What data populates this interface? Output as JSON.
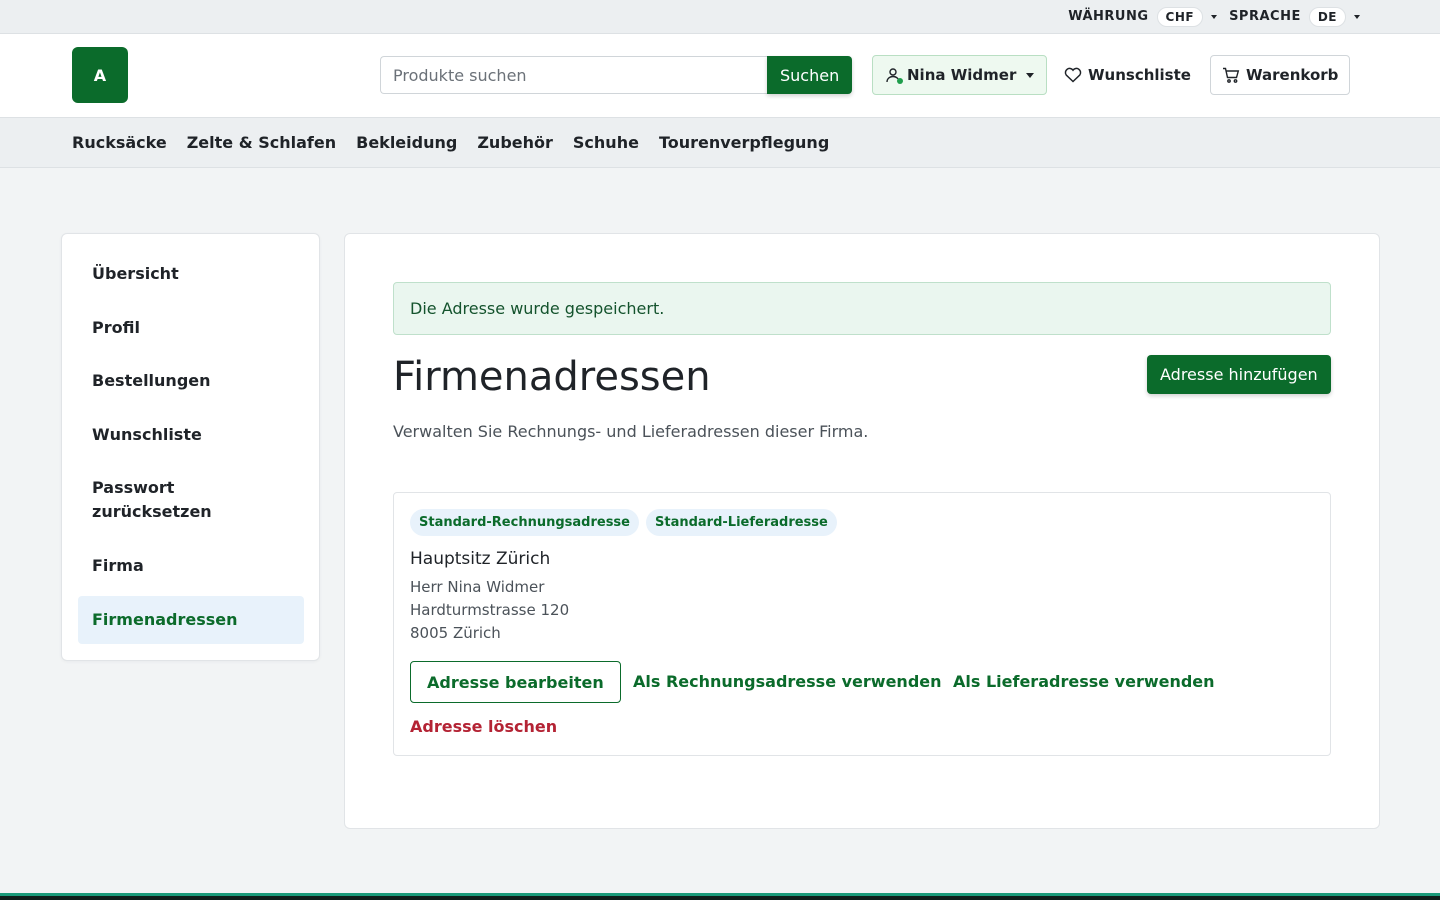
{
  "utility": {
    "currency_label": "WÄHRUNG",
    "currency_value": "CHF",
    "language_label": "SPRACHE",
    "language_value": "DE"
  },
  "header": {
    "logo_text": "A",
    "search_placeholder": "Produkte suchen",
    "search_button": "Suchen",
    "account_name": "Nina Widmer",
    "wishlist_label": "Wunschliste",
    "cart_label": "Warenkorb"
  },
  "categories": [
    "Rucksäcke",
    "Zelte & Schlafen",
    "Bekleidung",
    "Zubehör",
    "Schuhe",
    "Tourenverpflegung"
  ],
  "sidebar": {
    "items": [
      {
        "label": "Übersicht"
      },
      {
        "label": "Profil"
      },
      {
        "label": "Bestellungen"
      },
      {
        "label": "Wunschliste"
      },
      {
        "label": "Passwort zurücksetzen"
      },
      {
        "label": "Firma"
      },
      {
        "label": "Firmenadressen",
        "active": true
      }
    ]
  },
  "main": {
    "alert": "Die Adresse wurde gespeichert.",
    "title": "Firmenadressen",
    "add_button": "Adresse hinzufügen",
    "subtitle": "Verwalten Sie Rechnungs- und Lieferadressen dieser Firma."
  },
  "address": {
    "badges": [
      "Standard-Rechnungsadresse",
      "Standard-Lieferadresse"
    ],
    "name": "Hauptsitz Zürich",
    "contact": "Herr Nina Widmer",
    "street": "Hardturmstrasse 120",
    "city": "8005 Zürich",
    "edit_button": "Adresse bearbeiten",
    "use_billing": "Als Rechnungsadresse verwenden",
    "use_shipping": "Als Lieferadresse verwenden",
    "delete": "Adresse löschen"
  },
  "colors": {
    "brand": "#0b6b2b",
    "danger": "#b42334",
    "active_bg": "#e8f2fb"
  }
}
